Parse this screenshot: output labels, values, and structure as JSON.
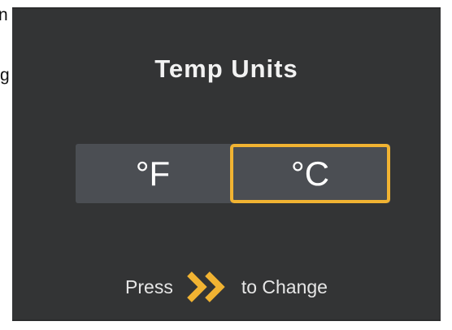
{
  "edge_fragments": [
    "n",
    "g"
  ],
  "screen": {
    "title": "Temp Units",
    "units": {
      "fahrenheit_label": "°F",
      "celsius_label": "°C",
      "selected": "°C"
    },
    "hint": {
      "before": "Press",
      "icon": "double-chevron-right-icon",
      "after": "to Change"
    }
  },
  "colors": {
    "screen_bg": "#333435",
    "toggle_bg": "#4b4e53",
    "accent": "#f1b332",
    "text": "#ffffff"
  }
}
